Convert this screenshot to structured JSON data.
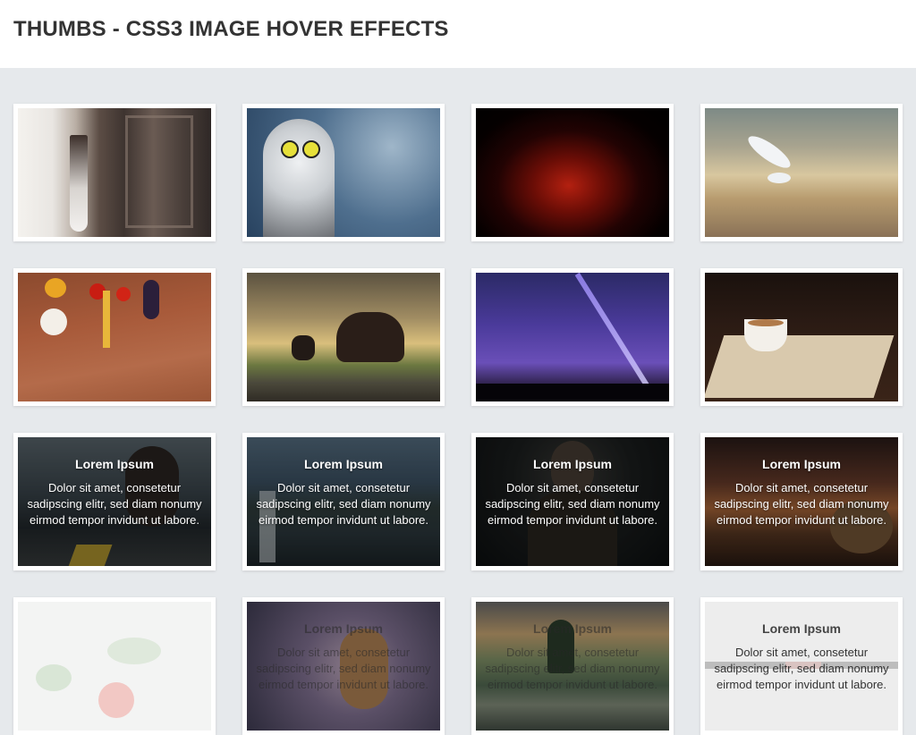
{
  "header": {
    "title": "THUMBS - CSS3 IMAGE HOVER EFFECTS"
  },
  "captions": [
    {
      "title": "Lorem Ipsum",
      "text": "Dolor sit amet, consetetur sadipscing elitr, sed diam nonumy eirmod tempor invidunt ut labore."
    },
    {
      "title": "Lorem Ipsum",
      "text": "Dolor sit amet, consetetur sadipscing elitr, sed diam nonumy eirmod tempor invidunt ut labore."
    },
    {
      "title": "Lorem Ipsum",
      "text": "Dolor sit amet, consetetur sadipscing elitr, sed diam nonumy eirmod tempor invidunt ut labore."
    },
    {
      "title": "Lorem Ipsum",
      "text": "Dolor sit amet, consetetur sadipscing elitr, sed diam nonumy eirmod tempor invidunt ut labore."
    },
    {
      "title": "Lorem Ipsum",
      "text": "Dolor sit amet, consetetur sadipscing elitr, sed diam nonumy eirmod tempor invidunt ut labore."
    },
    {
      "title": "Lorem Ipsum",
      "text": "Dolor sit amet, consetetur sadipscing elitr, sed diam nonumy eirmod tempor invidunt ut labore."
    },
    {
      "title": "Lorem Ipsum",
      "text": "Dolor sit amet, consetetur sadipscing elitr, sed diam nonumy eirmod tempor invidunt ut labore."
    }
  ],
  "thumbnails": [
    {
      "image": "bride-at-window-image"
    },
    {
      "image": "snowy-owl-image"
    },
    {
      "image": "red-space-nebula-image"
    },
    {
      "image": "seagull-over-lake-image"
    },
    {
      "image": "vegetables-on-wood-image"
    },
    {
      "image": "cats-at-sunset-image"
    },
    {
      "image": "purple-night-sky-image"
    },
    {
      "image": "coffee-cup-tray-image"
    },
    {
      "image": "runner-tying-shoe-image"
    },
    {
      "image": "waterfall-landscape-image"
    },
    {
      "image": "bald-man-portrait-image"
    },
    {
      "image": "hay-bale-sunset-image"
    },
    {
      "image": "tomatoes-splash-image"
    },
    {
      "image": "owl-on-branch-image"
    },
    {
      "image": "mountain-lake-island-image"
    },
    {
      "image": "red-flower-image"
    }
  ]
}
